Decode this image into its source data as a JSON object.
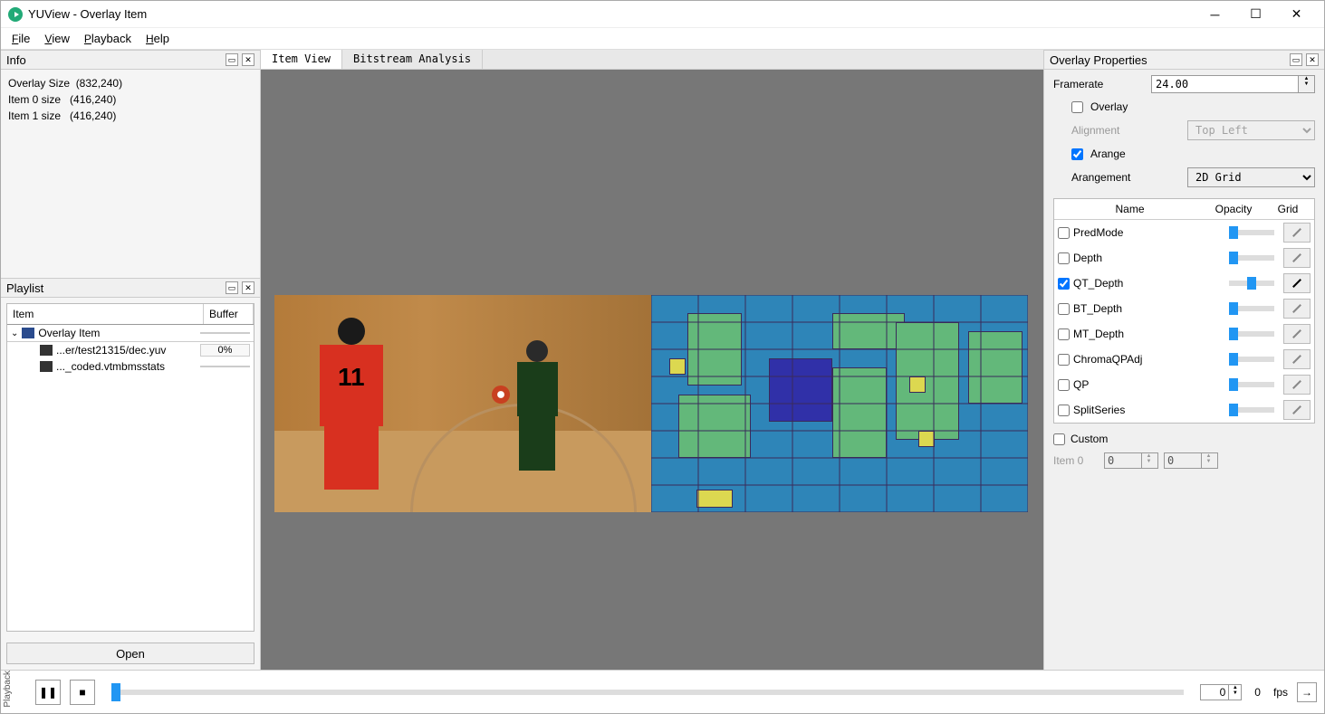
{
  "window": {
    "title": "YUView - Overlay Item"
  },
  "menu": {
    "file": "File",
    "view": "View",
    "playback": "Playback",
    "help": "Help"
  },
  "info": {
    "title": "Info",
    "lines": [
      "Overlay Size  (832,240)",
      "Item 0 size   (416,240)",
      "Item 1 size   (416,240)"
    ]
  },
  "playlist": {
    "title": "Playlist",
    "col_item": "Item",
    "col_buffer": "Buffer",
    "root": "Overlay Item",
    "items": [
      {
        "name": "...er/test21315/dec.yuv",
        "buffer": "0%"
      },
      {
        "name": "..._coded.vtmbmsstats",
        "buffer": ""
      }
    ],
    "open": "Open"
  },
  "tabs": {
    "item_view": "Item View",
    "bitstream": "Bitstream Analysis"
  },
  "props": {
    "title": "Overlay Properties",
    "framerate_label": "Framerate",
    "framerate": "24.00",
    "overlay": "Overlay",
    "alignment_label": "Alignment",
    "alignment": "Top Left",
    "arange": "Arange",
    "arangement_label": "Arangement",
    "arangement": "2D Grid",
    "headers": {
      "name": "Name",
      "opacity": "Opacity",
      "grid": "Grid"
    },
    "overlays": [
      {
        "name": "PredMode",
        "checked": false,
        "opacity": 0
      },
      {
        "name": "Depth",
        "checked": false,
        "opacity": 0
      },
      {
        "name": "QT_Depth",
        "checked": true,
        "opacity": 40
      },
      {
        "name": "BT_Depth",
        "checked": false,
        "opacity": 0
      },
      {
        "name": "MT_Depth",
        "checked": false,
        "opacity": 0
      },
      {
        "name": "ChromaQPAdj",
        "checked": false,
        "opacity": 0
      },
      {
        "name": "QP",
        "checked": false,
        "opacity": 0
      },
      {
        "name": "SplitSeries",
        "checked": false,
        "opacity": 0
      }
    ],
    "custom": "Custom",
    "item0_label": "Item 0",
    "item0_a": "0",
    "item0_b": "0"
  },
  "playback": {
    "title": "Playback",
    "frame_input": "0",
    "frame_count": "0",
    "fps_label": "fps"
  }
}
